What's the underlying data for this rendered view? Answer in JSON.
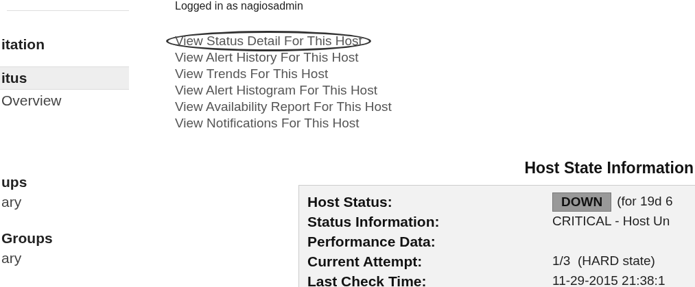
{
  "sidebar": {
    "groups": [
      {
        "items": [
          {
            "label": "itation",
            "kind": "heading",
            "selected": false
          }
        ]
      },
      {
        "items": [
          {
            "label": "itus",
            "kind": "heading",
            "selected": true
          },
          {
            "label": "Overview",
            "kind": "link",
            "selected": false
          }
        ]
      },
      {
        "items": [
          {
            "label": "ups",
            "kind": "heading",
            "selected": false
          },
          {
            "label": "ary",
            "kind": "link",
            "selected": false
          }
        ]
      },
      {
        "items": [
          {
            "label": "Groups",
            "kind": "heading",
            "selected": false
          },
          {
            "label": "ary",
            "kind": "link",
            "selected": false
          }
        ]
      }
    ]
  },
  "login": "Logged in as nagiosadmin",
  "links": [
    {
      "label": "View Status Detail For This Host",
      "circled": true
    },
    {
      "label": "View Alert History For This Host",
      "circled": false
    },
    {
      "label": "View Trends For This Host",
      "circled": false
    },
    {
      "label": "View Alert Histogram For This Host",
      "circled": false
    },
    {
      "label": "View Availability Report For This Host",
      "circled": false
    },
    {
      "label": "View Notifications For This Host",
      "circled": false
    }
  ],
  "host_state": {
    "title": "Host State Information",
    "rows": [
      {
        "label": "Host Status:",
        "kind": "status",
        "badge": "DOWN",
        "value": "(for 19d 6"
      },
      {
        "label": "Status Information:",
        "kind": "text",
        "value": "CRITICAL - Host Un"
      },
      {
        "label": "Performance Data:",
        "kind": "text"
      },
      {
        "label": "Current Attempt:",
        "kind": "text",
        "value": "1/3  (HARD state)"
      },
      {
        "label": "Last Check Time:",
        "kind": "text",
        "value": "11-29-2015 21:38:1"
      }
    ]
  }
}
